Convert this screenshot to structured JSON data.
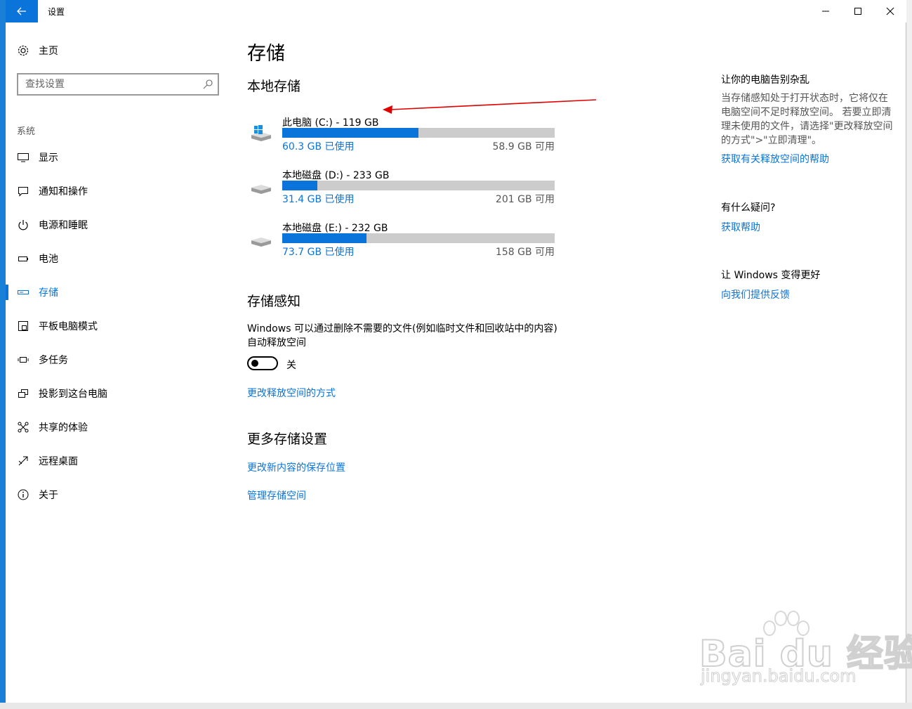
{
  "window": {
    "title": "设置"
  },
  "sidebar": {
    "home_label": "主页",
    "search_placeholder": "查找设置",
    "section_label": "系统",
    "items": [
      {
        "label": "显示",
        "icon": "monitor-icon"
      },
      {
        "label": "通知和操作",
        "icon": "notification-icon"
      },
      {
        "label": "电源和睡眠",
        "icon": "power-icon"
      },
      {
        "label": "电池",
        "icon": "battery-icon"
      },
      {
        "label": "存储",
        "icon": "storage-icon",
        "active": true
      },
      {
        "label": "平板电脑模式",
        "icon": "tablet-icon"
      },
      {
        "label": "多任务",
        "icon": "multitask-icon"
      },
      {
        "label": "投影到这台电脑",
        "icon": "project-icon"
      },
      {
        "label": "共享的体验",
        "icon": "share-icon"
      },
      {
        "label": "远程桌面",
        "icon": "remote-desktop-icon"
      },
      {
        "label": "关于",
        "icon": "info-icon"
      }
    ]
  },
  "main": {
    "title": "存储",
    "local_storage_heading": "本地存储",
    "drives": [
      {
        "name": "此电脑 (C:) - 119 GB",
        "used": "60.3 GB 已使用",
        "free": "58.9 GB 可用",
        "used_fraction": 0.5
      },
      {
        "name": "本地磁盘 (D:) - 233 GB",
        "used": "31.4 GB 已使用",
        "free": "201 GB 可用",
        "used_fraction": 0.13
      },
      {
        "name": "本地磁盘 (E:) - 232 GB",
        "used": "73.7 GB 已使用",
        "free": "158 GB 可用",
        "used_fraction": 0.31
      }
    ],
    "storage_sense": {
      "heading": "存储感知",
      "description": "Windows 可以通过删除不需要的文件(例如临时文件和回收站中的内容)自动释放空间",
      "toggle_state": "关",
      "change_link": "更改释放空间的方式"
    },
    "more": {
      "heading": "更多存储设置",
      "link_save_location": "更改新内容的保存位置",
      "link_manage": "管理存储空间"
    }
  },
  "right_panel": {
    "heading1": "让你的电脑告别杂乱",
    "body1": "当存储感知处于打开状态时，它将仅在电脑空间不足时释放空间。 若要立即清理未使用的文件，请选择\"更改释放空间的方式\">\"立即清理\"。",
    "link1": "获取有关释放空间的帮助",
    "heading2": "有什么疑问?",
    "link2": "获取帮助",
    "heading3": "让 Windows 变得更好",
    "link3": "向我们提供反馈"
  },
  "watermark": {
    "brand": "Bai du 经验",
    "site": "jingyan.baidu.com"
  },
  "colors": {
    "accent": "#0a74da",
    "bar_track": "#cccccc",
    "arrow": "#e00000"
  }
}
